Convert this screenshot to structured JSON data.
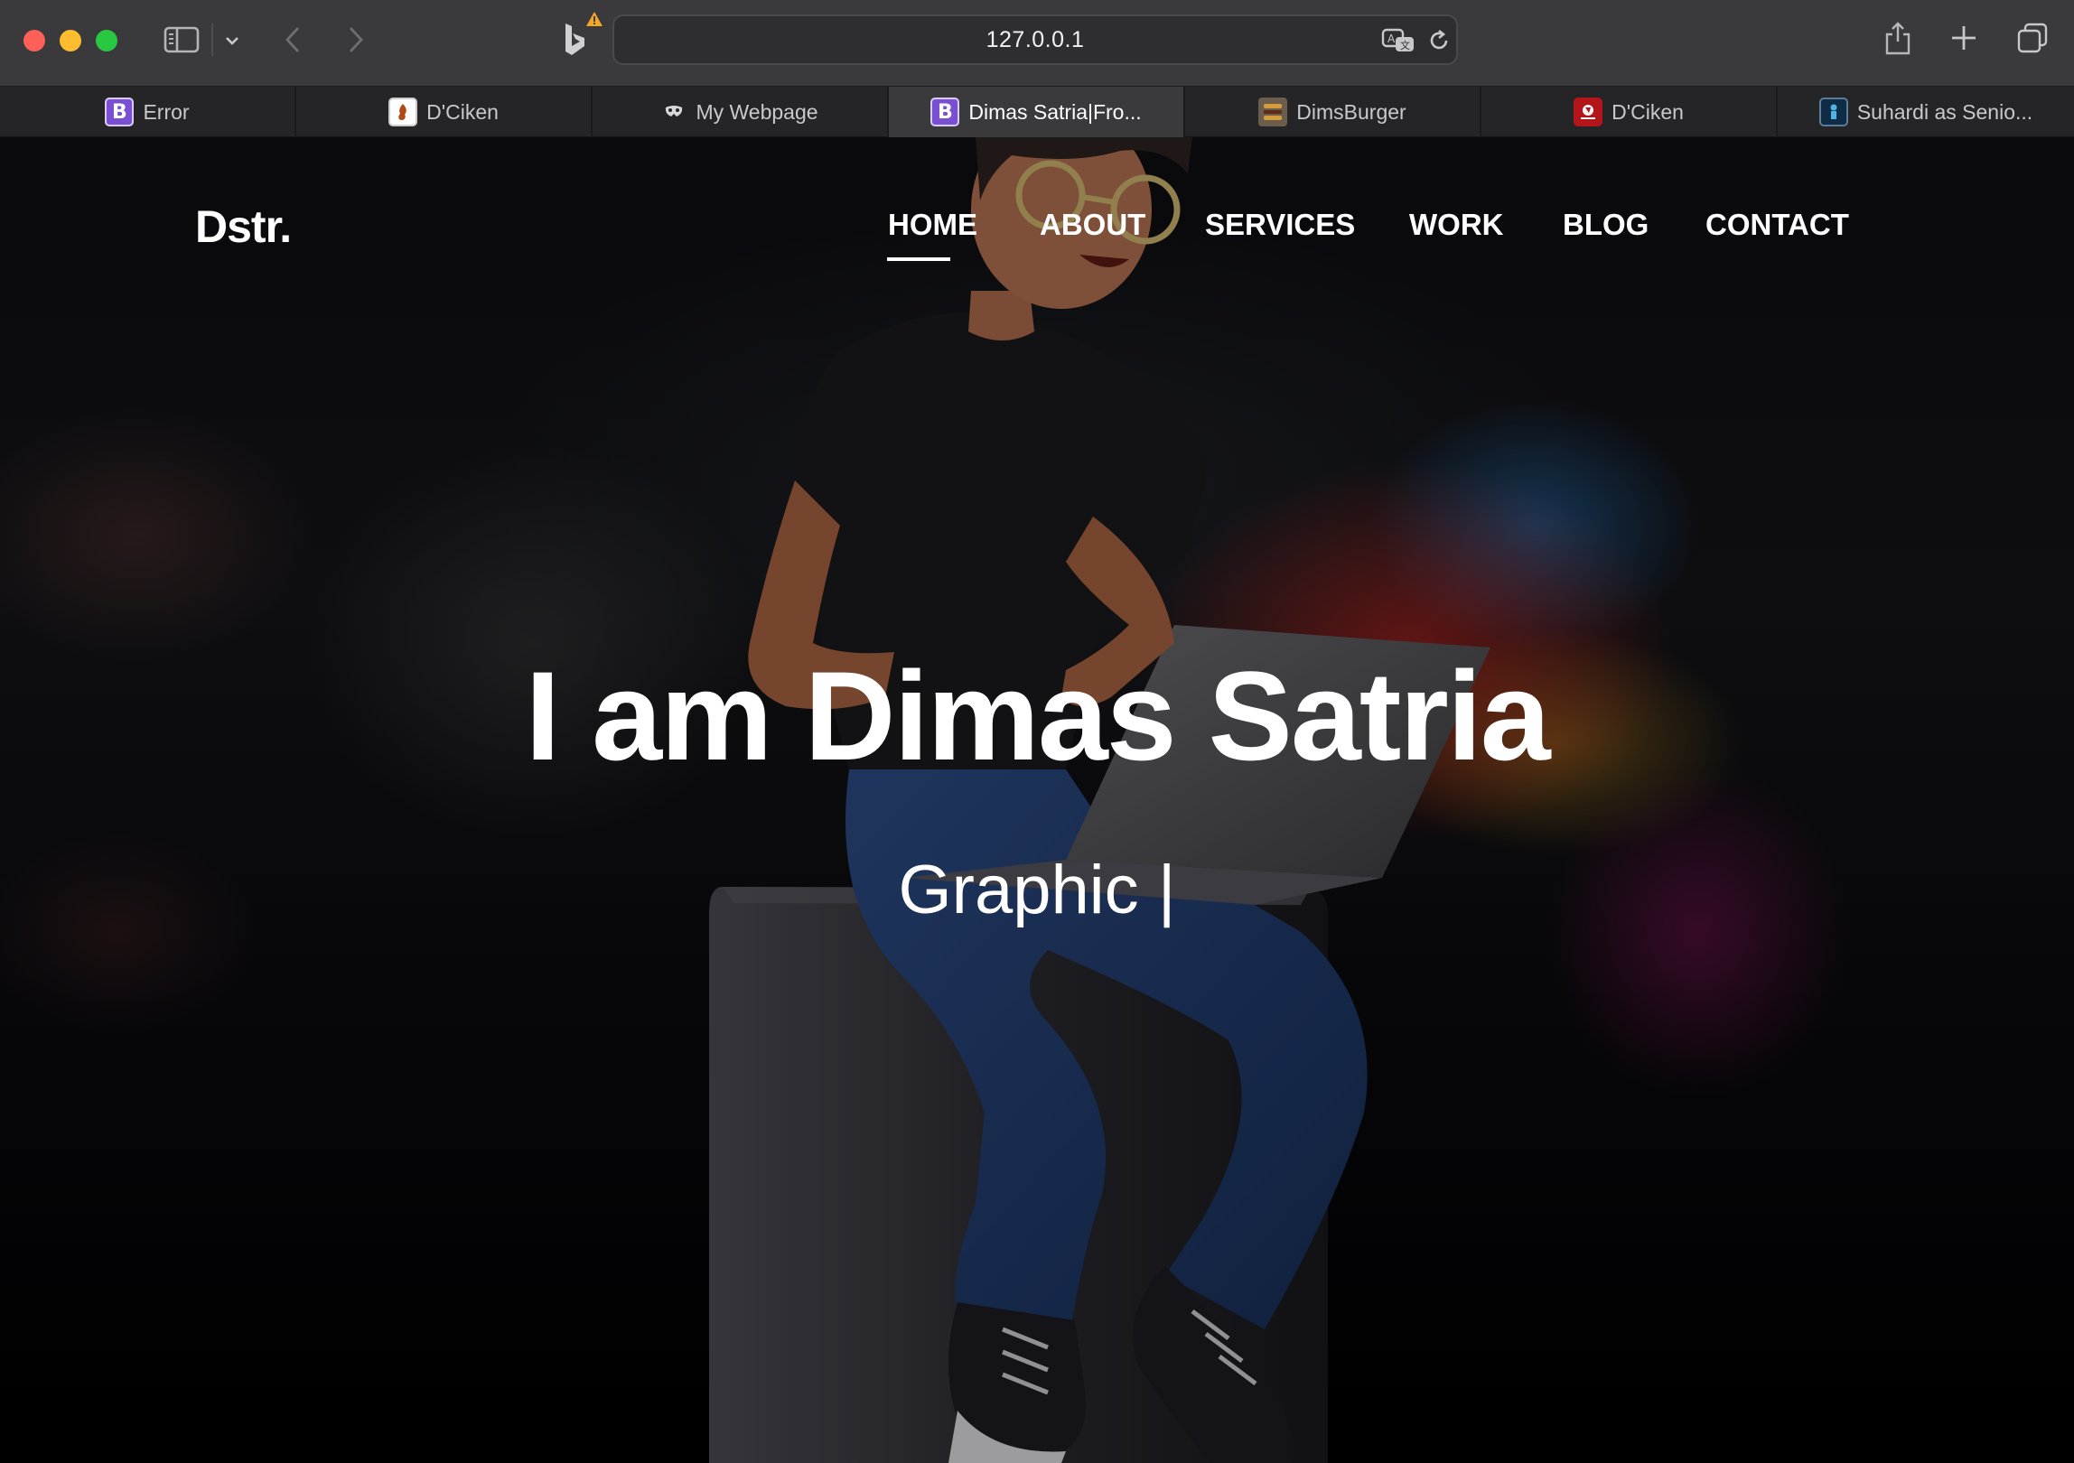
{
  "browser": {
    "url": "127.0.0.1",
    "tabs": [
      {
        "title": "Error",
        "favicon": "bootstrap-icon",
        "active": false
      },
      {
        "title": "D'Ciken",
        "favicon": "dciken-icon",
        "active": false
      },
      {
        "title": "My Webpage",
        "favicon": "mask-icon",
        "active": false
      },
      {
        "title": "Dimas Satria|Fro...",
        "favicon": "bootstrap-icon",
        "active": true
      },
      {
        "title": "DimsBurger",
        "favicon": "burger-icon",
        "active": false
      },
      {
        "title": "D'Ciken",
        "favicon": "dciken-icon",
        "active": false
      },
      {
        "title": "Suhardi as Senio...",
        "favicon": "suhardi-icon",
        "active": false
      }
    ],
    "colors": {
      "toolbar": "#3a3a3c",
      "tabbar": "#252527",
      "close": "#fe5f57",
      "minimize": "#febc2e",
      "zoom": "#28c840"
    }
  },
  "site": {
    "logo": "Dstr.",
    "nav": [
      "HOME",
      "ABOUT",
      "SERVICES",
      "WORK",
      "BLOG",
      "CONTACT"
    ],
    "active_nav": "HOME",
    "hero_title": "I am Dimas Satria",
    "hero_subtitle": "Graphic |"
  }
}
